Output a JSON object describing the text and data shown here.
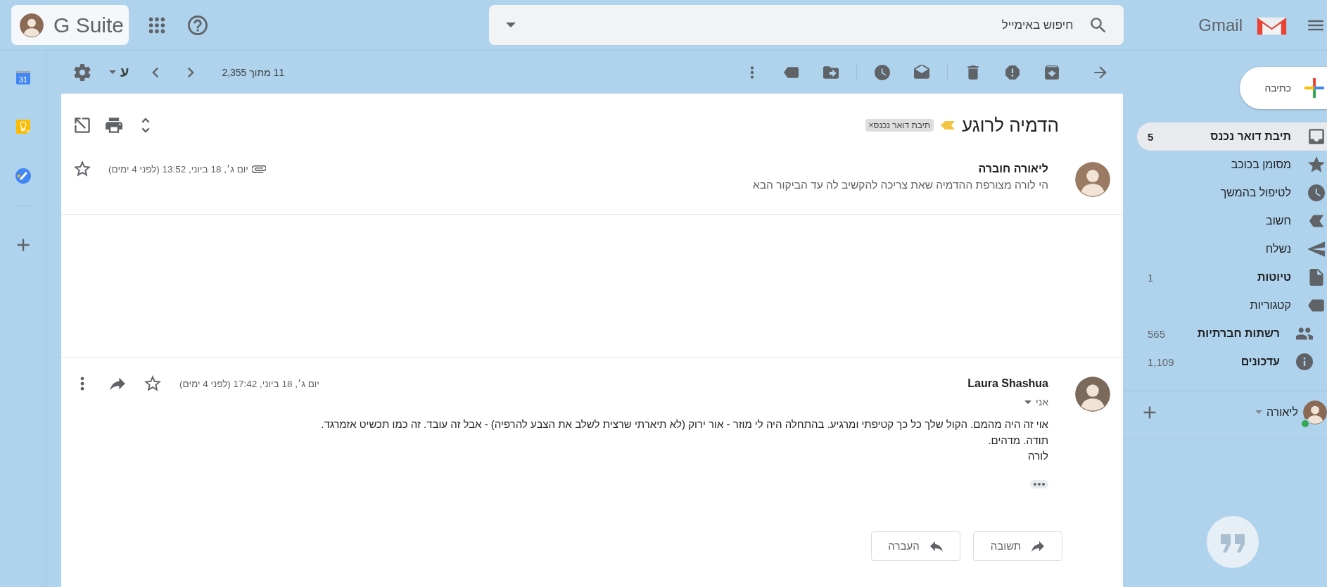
{
  "header": {
    "account_label": "G Suite",
    "search": {
      "placeholder": "חיפוש באימייל"
    },
    "brand": "Gmail"
  },
  "rail": {
    "calendar_day": "31"
  },
  "toolbar": {
    "pagination": "11 מתוך 2,355",
    "input_tool": "ע"
  },
  "thread": {
    "subject": "הדמיה לרוגע",
    "important": true,
    "labels": [
      {
        "text": "תיבת דואר נכנס",
        "remove": "×"
      }
    ],
    "messages": [
      {
        "kind": "collapsed",
        "sender": "ליאורה חוברה",
        "snippet": "הי לורה מצורפת ההדמיה שאת צריכה להקשיב לה עד הביקור הבא",
        "date": "יום ג׳, 18 ביוני, 13:52 (לפני 4 ימים)",
        "attachment": true,
        "starred": false
      },
      {
        "kind": "expanded",
        "sender": "Laura Shashua",
        "recipient": "אני",
        "date": "יום ג׳, 18 ביוני, 17:42 (לפני 4 ימים)",
        "starred": false,
        "trimmed": true,
        "body": [
          "אוי זה היה מהמם. הקול שלך כל כך קטיפתי ומרגיע. בהתחלה היה לי מוזר - אור ירוק (לא תיארתי שרצית לשלב את הצבע להרפיה) - אבל זה עובד. זה כמו תכשיט אזמרגד.",
          "תודה. מדהים.",
          "לורה"
        ]
      }
    ],
    "actions": [
      {
        "kind": "reply",
        "label": "תשובה"
      },
      {
        "kind": "forward",
        "label": "העברה"
      }
    ]
  },
  "sidebar": {
    "compose": "כתיבה",
    "items": [
      {
        "kind": "inbox",
        "label": "תיבת דואר נכנס",
        "count": "5",
        "bold": true,
        "selected": true
      },
      {
        "kind": "starred",
        "label": "מסומן בכוכב",
        "bold": false,
        "selected": false
      },
      {
        "kind": "snoozed",
        "label": "לטיפול בהמשך",
        "bold": false,
        "selected": false
      },
      {
        "kind": "important",
        "label": "חשוב",
        "bold": false,
        "selected": false
      },
      {
        "kind": "sent",
        "label": "נשלח",
        "bold": false,
        "selected": false
      },
      {
        "kind": "drafts",
        "label": "טיוטות",
        "count": "1",
        "bold": true,
        "selected": false
      },
      {
        "kind": "categories",
        "label": "קטגוריות",
        "bold": false,
        "selected": false,
        "children": [
          {
            "kind": "social",
            "label": "רשתות חברתיות",
            "count": "565",
            "bold": true,
            "selected": false
          },
          {
            "kind": "updates",
            "label": "עדכונים",
            "count": "1,109",
            "bold": true,
            "selected": false
          }
        ]
      }
    ],
    "hangouts": {
      "user": "ליאורה",
      "online": true
    }
  }
}
